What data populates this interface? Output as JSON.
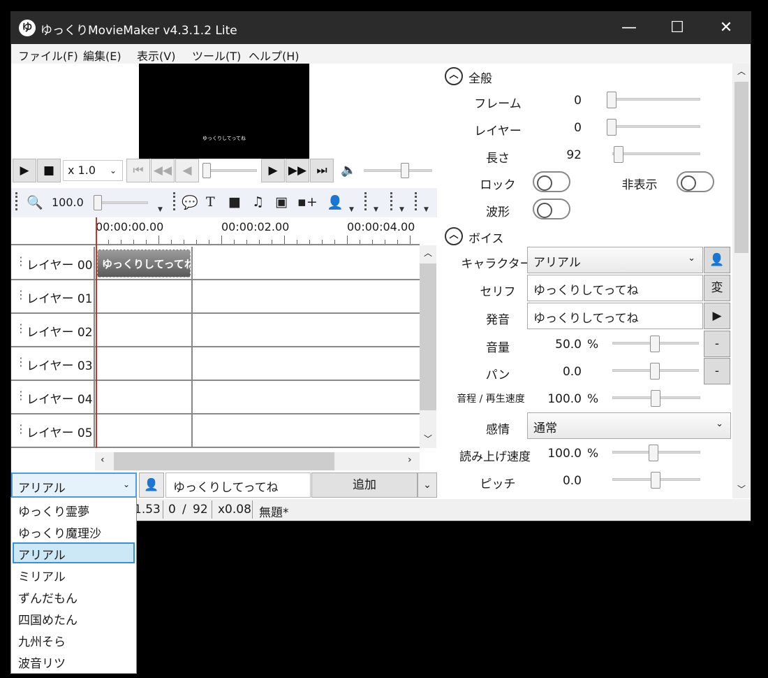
{
  "window": {
    "title": "ゆっくりMovieMaker v4.3.1.2 Lite",
    "logo_glyph": "ゆ",
    "minimize_glyph": "—",
    "maximize_glyph": "☐",
    "close_glyph": "✕"
  },
  "menu": [
    "ファイル(F)",
    "編集(E)",
    "表示(V)",
    "ツール(T)",
    "ヘルプ(H)"
  ],
  "preview": {
    "caption": "ゆっくりしてってね"
  },
  "transport": {
    "speed": "x 1.0",
    "seek_position": 0.0,
    "volume_level": 0.62
  },
  "timeline_toolbar": {
    "zoom": "100.0",
    "zoom_level": 0.0
  },
  "ruler": {
    "labels": [
      "00:00:00.00",
      "00:00:02.00",
      "00:00:04.00"
    ]
  },
  "layers": [
    "レイヤー 00",
    "レイヤー 01",
    "レイヤー 02",
    "レイヤー 03",
    "レイヤー 04",
    "レイヤー 05"
  ],
  "clip": {
    "text": "ゆっくりしてってね"
  },
  "input_bar": {
    "character": "アリアル",
    "serif": "ゆっくりしてってね",
    "add_label": "追加"
  },
  "status": {
    "time": "1.53",
    "frame": "0",
    "frame_sep": "/",
    "total_frames": "92",
    "zoom": "x0.08",
    "project": "無題*"
  },
  "character_list": {
    "options": [
      "ゆっくり霊夢",
      "ゆっくり魔理沙",
      "アリアル",
      "ミリアル",
      "ずんだもん",
      "四国めたん",
      "九州そら",
      "波音リツ"
    ],
    "selected_index": 2
  },
  "properties": {
    "general": {
      "title": "全般",
      "frame_label": "フレーム",
      "frame_value": "0",
      "layer_label": "レイヤー",
      "layer_value": "0",
      "length_label": "長さ",
      "length_value": "92",
      "lock_label": "ロック",
      "hidden_label": "非表示",
      "waveform_label": "波形"
    },
    "voice": {
      "title": "ボイス",
      "character_label": "キャラクター",
      "character_value": "アリアル",
      "serif_label": "セリフ",
      "serif_value": "ゆっくりしてってね",
      "convert_label": "変",
      "pronunciation_label": "発音",
      "pronunciation_value": "ゆっくりしてってね",
      "volume_label": "音量",
      "volume_value": "50.0",
      "volume_unit": "%",
      "volume_button": "-",
      "pan_label": "パン",
      "pan_value": "0.0",
      "pan_button": "-",
      "pitch_speed_label": "音程 / 再生速度",
      "pitch_speed_value": "100.0",
      "pitch_speed_unit": "%",
      "emotion_label": "感情",
      "emotion_value": "通常",
      "read_speed_label": "読み上げ速度",
      "read_speed_value": "100.0",
      "read_speed_unit": "%",
      "pitch_label": "ピッチ",
      "pitch_value": "0.0"
    }
  }
}
